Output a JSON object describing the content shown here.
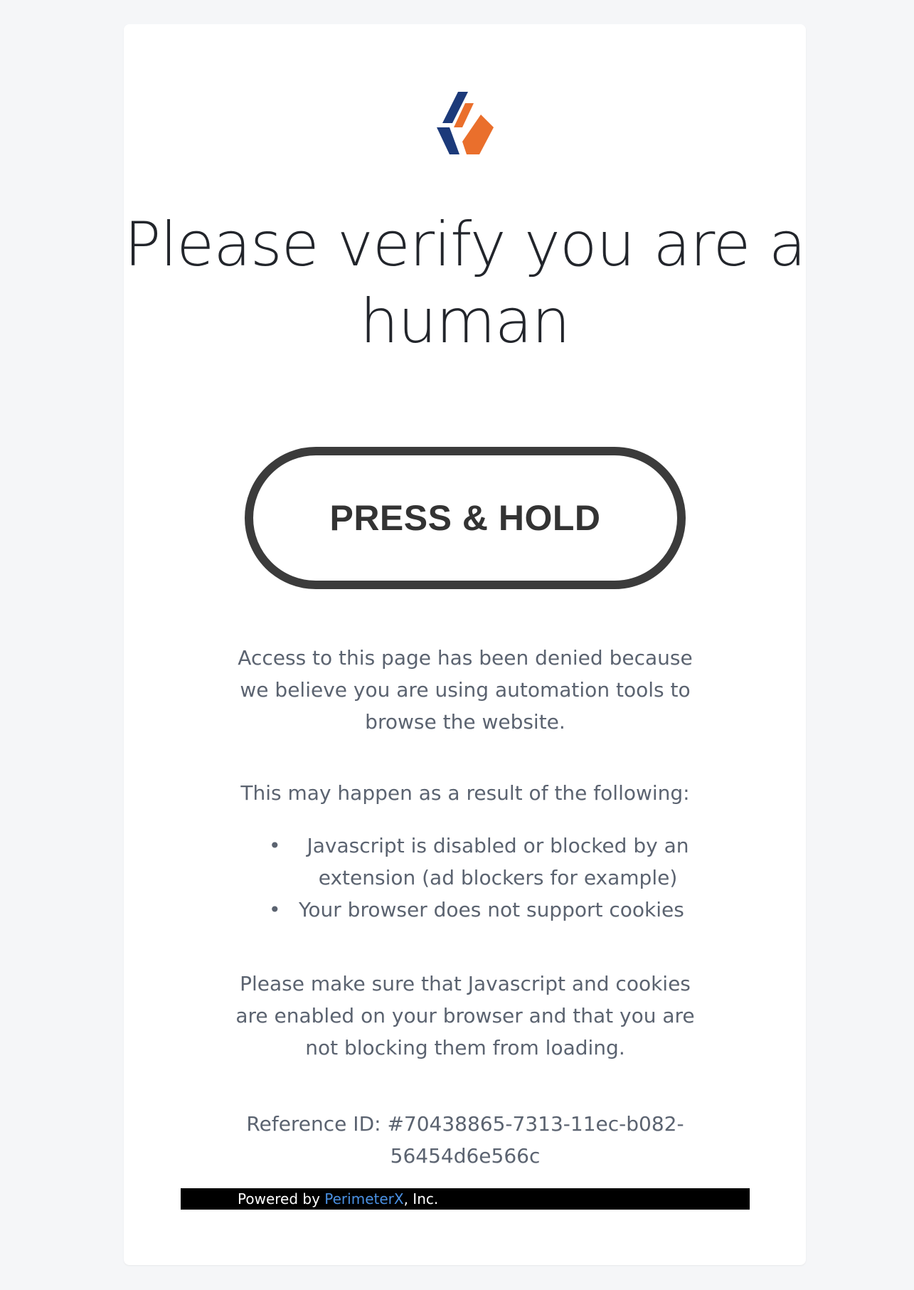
{
  "challenge": {
    "title": "Please verify you are a human",
    "button_label": "PRESS & HOLD",
    "denied_text": "Access to this page has been denied because we believe you are using automation tools to browse the website.",
    "reasons_intro": "This may happen as a result of the following:",
    "reasons": [
      "Javascript is disabled or blocked by an extension (ad blockers for example)",
      "Your browser does not support cookies"
    ],
    "instructions": "Please make sure that Javascript and cookies are enabled on your browser and that you are not blocking them from loading.",
    "reference_text": "Reference ID: #70438865-7313-11ec-b082-56454d6e566c"
  },
  "footer": {
    "powered_by": "Powered by ",
    "company_link": "PerimeterX",
    "company_suffix": ", Inc."
  },
  "colors": {
    "logo_blue": "#1c3a7a",
    "logo_orange": "#ea6f2c",
    "link": "#4a90e2",
    "body_text": "#5b6370",
    "button_border": "#3b3b3b"
  },
  "icons": {
    "logo": "perimeterx-logo"
  }
}
